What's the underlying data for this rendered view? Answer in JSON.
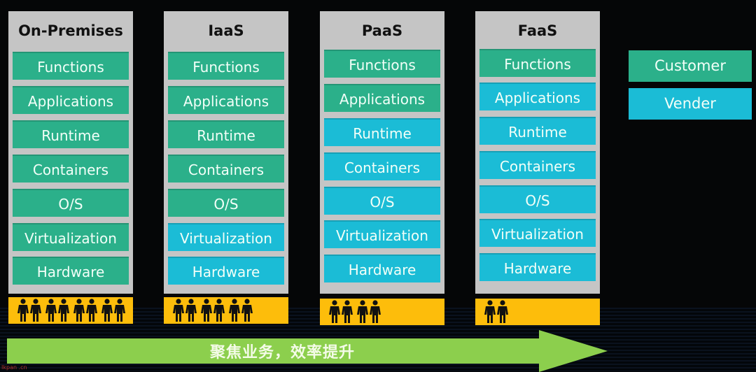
{
  "columns": [
    {
      "title": "On-Premises",
      "people_count": 8,
      "layers": [
        {
          "label": "Functions",
          "owner": "customer"
        },
        {
          "label": "Applications",
          "owner": "customer"
        },
        {
          "label": "Runtime",
          "owner": "customer"
        },
        {
          "label": "Containers",
          "owner": "customer"
        },
        {
          "label": "O/S",
          "owner": "customer"
        },
        {
          "label": "Virtualization",
          "owner": "customer"
        },
        {
          "label": "Hardware",
          "owner": "customer"
        }
      ]
    },
    {
      "title": "IaaS",
      "people_count": 6,
      "layers": [
        {
          "label": "Functions",
          "owner": "customer"
        },
        {
          "label": "Applications",
          "owner": "customer"
        },
        {
          "label": "Runtime",
          "owner": "customer"
        },
        {
          "label": "Containers",
          "owner": "customer"
        },
        {
          "label": "O/S",
          "owner": "customer"
        },
        {
          "label": "Virtualization",
          "owner": "vendor"
        },
        {
          "label": "Hardware",
          "owner": "vendor"
        }
      ]
    },
    {
      "title": "PaaS",
      "people_count": 4,
      "layers": [
        {
          "label": "Functions",
          "owner": "customer"
        },
        {
          "label": "Applications",
          "owner": "customer"
        },
        {
          "label": "Runtime",
          "owner": "vendor"
        },
        {
          "label": "Containers",
          "owner": "vendor"
        },
        {
          "label": "O/S",
          "owner": "vendor"
        },
        {
          "label": "Virtualization",
          "owner": "vendor"
        },
        {
          "label": "Hardware",
          "owner": "vendor"
        }
      ]
    },
    {
      "title": "FaaS",
      "people_count": 2,
      "layers": [
        {
          "label": "Functions",
          "owner": "customer"
        },
        {
          "label": "Applications",
          "owner": "vendor"
        },
        {
          "label": "Runtime",
          "owner": "vendor"
        },
        {
          "label": "Containers",
          "owner": "vendor"
        },
        {
          "label": "O/S",
          "owner": "vendor"
        },
        {
          "label": "Virtualization",
          "owner": "vendor"
        },
        {
          "label": "Hardware",
          "owner": "vendor"
        }
      ]
    }
  ],
  "legend": {
    "customer_label": "Customer",
    "vendor_label": "Vender"
  },
  "arrow": {
    "label": "聚焦业务，效率提升"
  },
  "colors": {
    "customer": "#2bb08a",
    "vendor": "#1bbcd6",
    "people_bar": "#fdbd0b",
    "arrow": "#8ccf4d",
    "column_bg": "#c5c5c5"
  },
  "watermark": "Ikpan .cn"
}
